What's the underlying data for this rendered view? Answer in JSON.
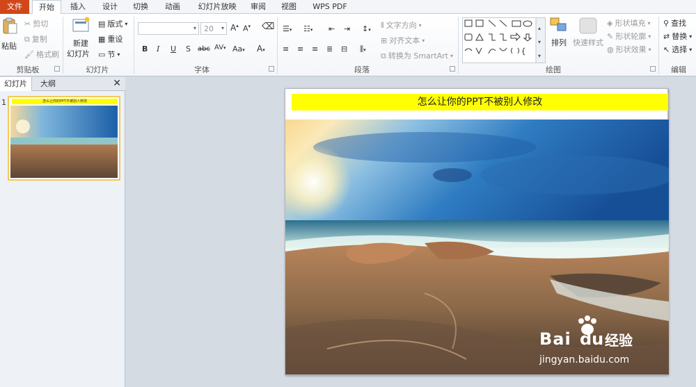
{
  "tabs": [
    "文件",
    "开始",
    "插入",
    "设计",
    "切换",
    "动画",
    "幻灯片放映",
    "审阅",
    "视图",
    "WPS PDF"
  ],
  "ribbon": {
    "clipboard": {
      "paste": "粘贴",
      "cut": "剪切",
      "copy": "复制",
      "format_painter": "格式刷",
      "title": "剪贴板"
    },
    "slides": {
      "new_slide_1": "新建",
      "new_slide_2": "幻灯片",
      "layout": "版式",
      "reset": "重设",
      "section": "节",
      "title": "幻灯片"
    },
    "font": {
      "font_name": "",
      "font_size": "20",
      "title": "字体"
    },
    "paragraph": {
      "text_direction": "文字方向",
      "align_text": "对齐文本",
      "smartart": "转换为 SmartArt",
      "title": "段落"
    },
    "drawing": {
      "arrange": "排列",
      "quick_styles": "快速样式",
      "shape_fill": "形状填充",
      "shape_outline": "形状轮廓",
      "shape_effects": "形状效果",
      "title": "绘图"
    },
    "editing": {
      "find": "查找",
      "replace": "替换",
      "select": "选择",
      "title": "编辑"
    }
  },
  "pane": {
    "tab_slides": "幻灯片",
    "tab_outline": "大纲",
    "slide_number": "1",
    "thumb_title": "怎么让你的PPT不被别人修改"
  },
  "slide": {
    "title": "怎么让你的PPT不被别人修改"
  },
  "watermark": {
    "brand": "Bai",
    "brand_cn": "经验",
    "url": "jingyan.baidu.com"
  }
}
